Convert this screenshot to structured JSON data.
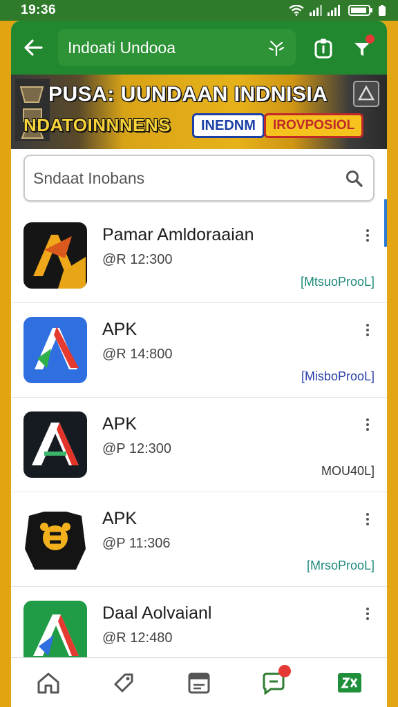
{
  "status_bar": {
    "time": "19:36"
  },
  "header": {
    "title": "Indoati Undooa"
  },
  "banner": {
    "title": "PUSA: UUNDAAN INDNISIA",
    "subtitle": "NDATOINNNENS",
    "chip_blue": "INEDNM",
    "chip_red": "IROVPOSIOL"
  },
  "search": {
    "placeholder": "Sndaat Inobans"
  },
  "apps": [
    {
      "name": "Pamar Amldoraaian",
      "price": "@R 12:300",
      "tag": "[MtsuoProoL]",
      "tag_color": "#1e8a7a"
    },
    {
      "name": "APK",
      "price": "@R 14:800",
      "tag": "[MisboProoL]",
      "tag_color": "#2b3fa8"
    },
    {
      "name": "APK",
      "price": "@P 12:300",
      "tag": "MOU40L]",
      "tag_color": "#333333"
    },
    {
      "name": "APK",
      "price": "@P 11:306",
      "tag": "[MrsoProoL]",
      "tag_color": "#1e8a7a"
    },
    {
      "name": "Daal Aolvaianl",
      "price": "@R 12:480",
      "tag": "",
      "tag_color": "#1e8a7a"
    }
  ],
  "icons": [
    "back-arrow-icon",
    "leaf-icon",
    "clipboard-icon",
    "filter-icon",
    "search-icon",
    "more-vert-icon",
    "home-icon",
    "tag-icon",
    "calendar-icon",
    "chat-icon",
    "games-icon"
  ],
  "colors": {
    "primary_green": "#22882f",
    "accent_gold": "#e6b21a",
    "badge_red": "#e53935"
  }
}
